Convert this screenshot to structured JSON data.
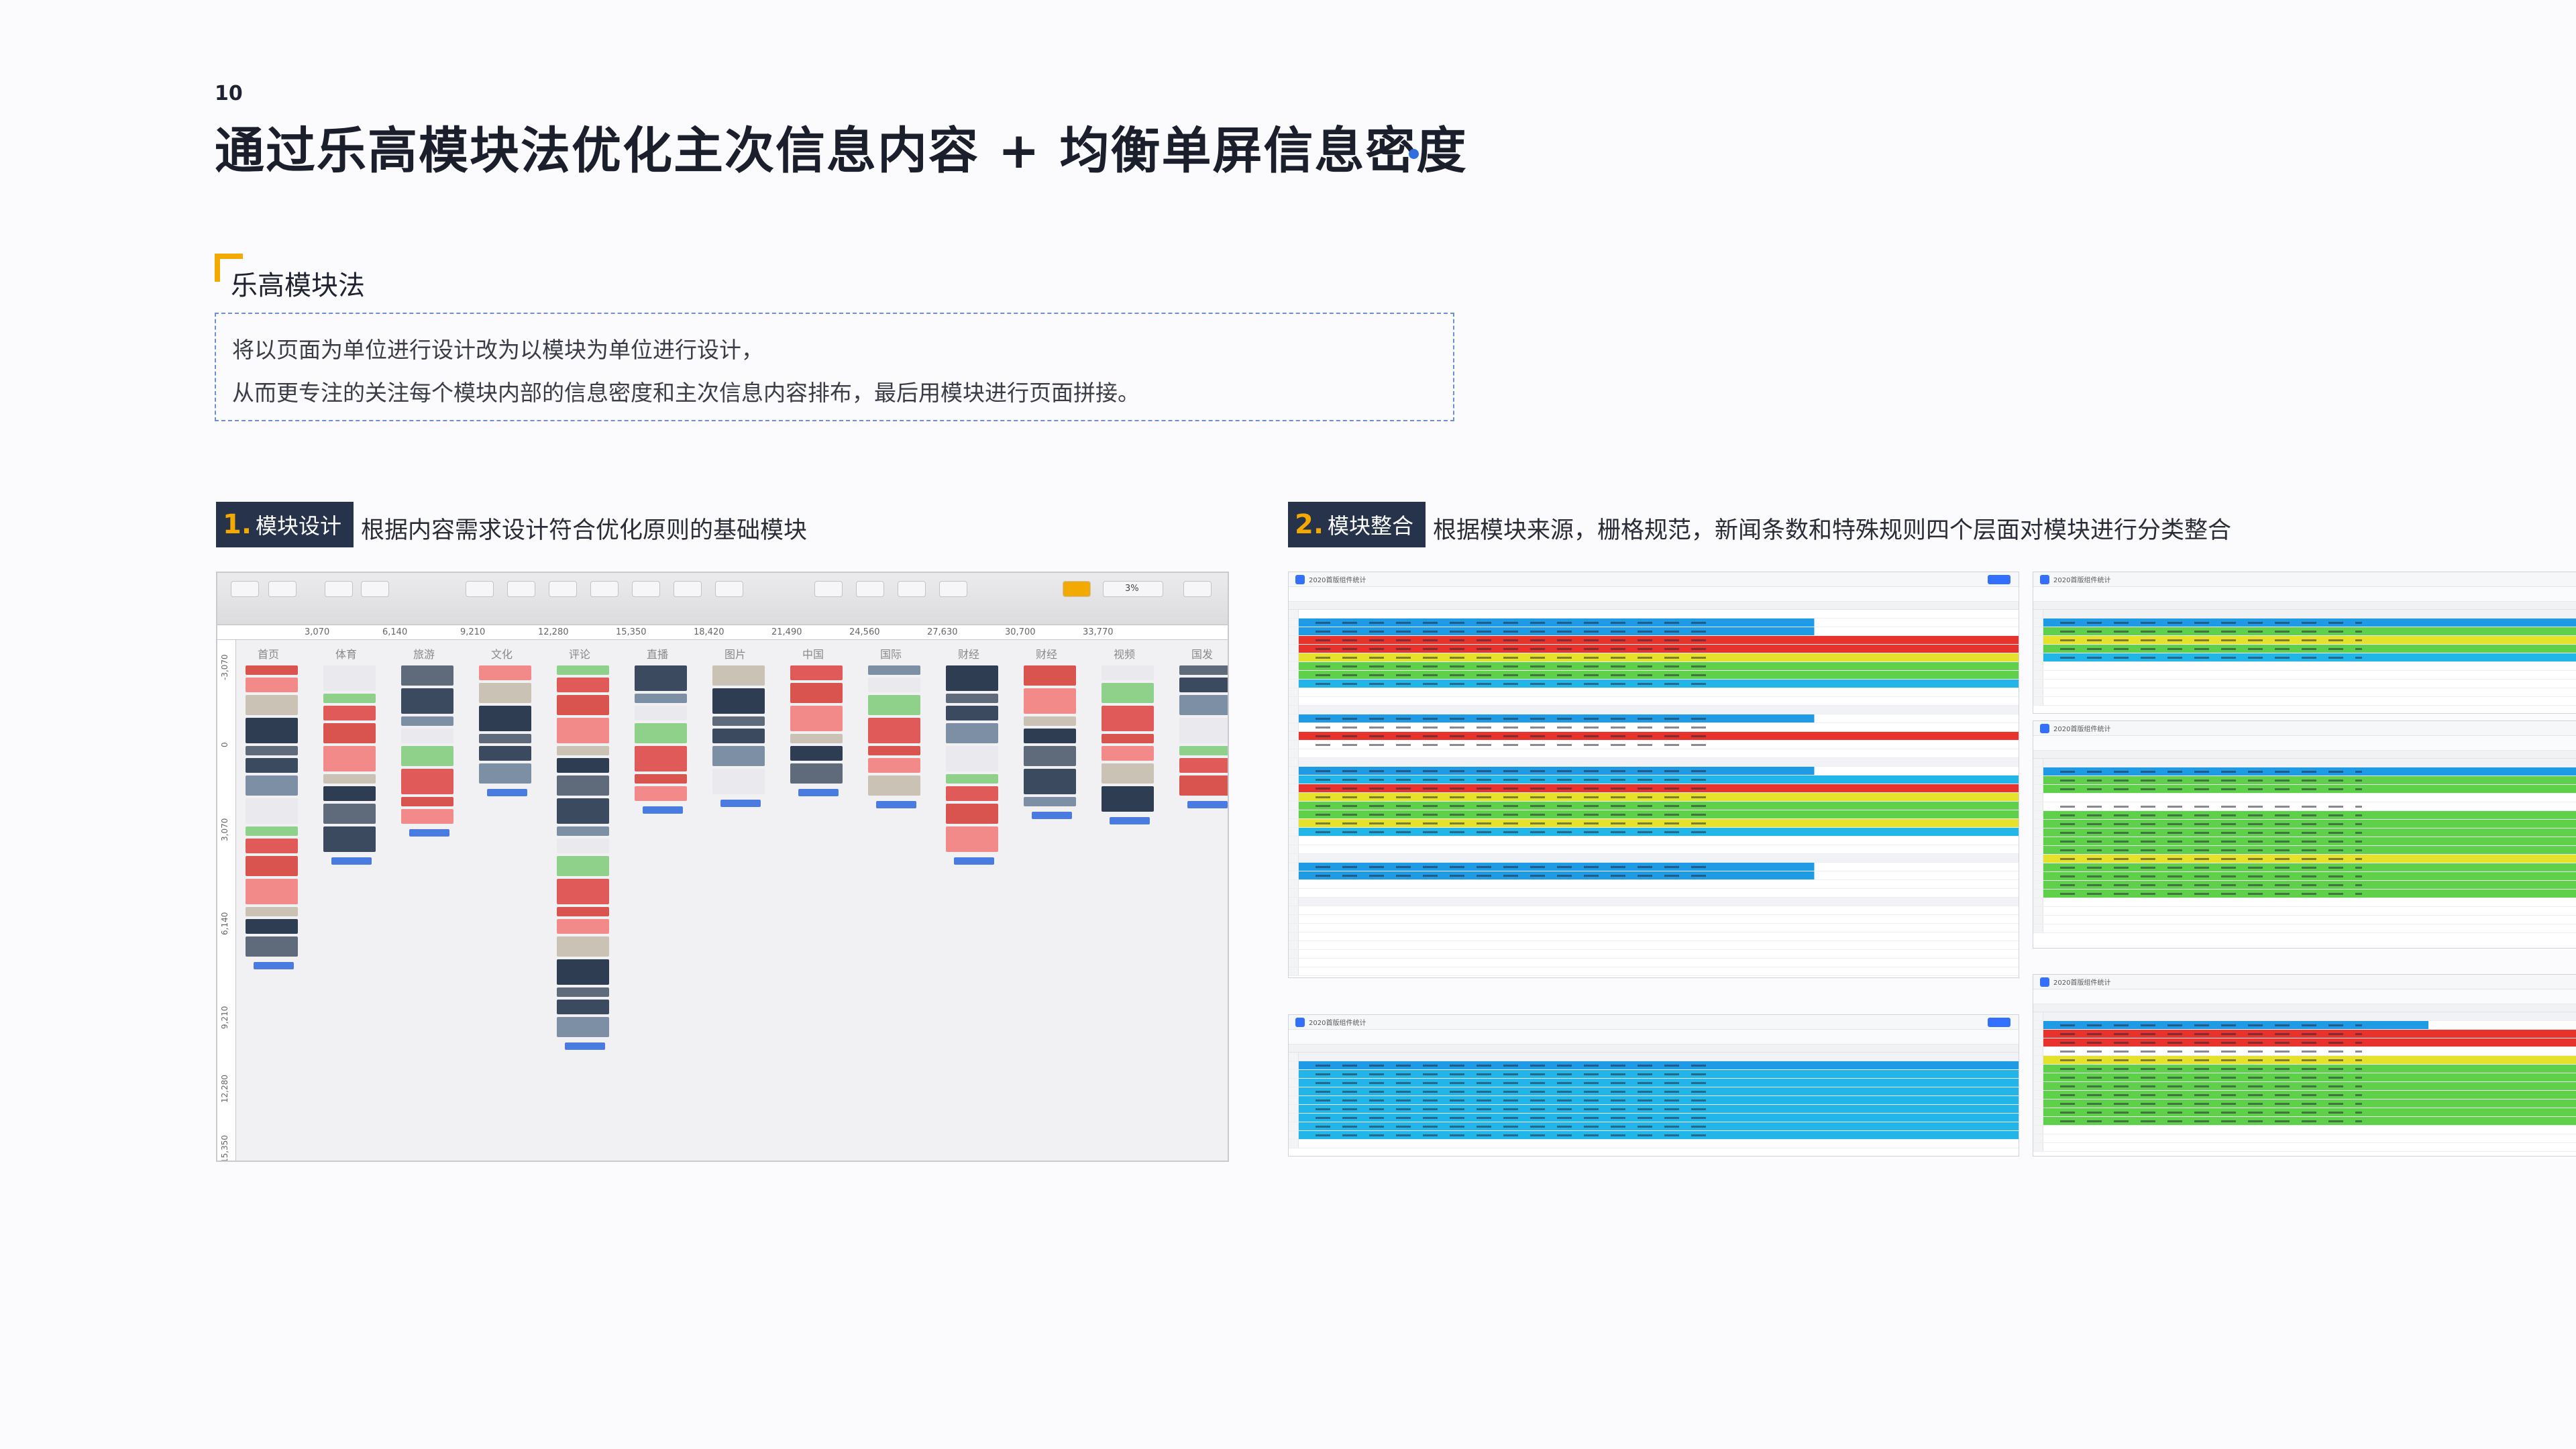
{
  "page": {
    "number": "10",
    "title": "通过乐高模块法优化主次信息内容 + 均衡单屏信息密度"
  },
  "section": {
    "title": "乐高模块法",
    "desc_lines": [
      "将以页面为单位进行设计改为以模块为单位进行设计，",
      "从而更专注的关注每个模块内部的信息密度和主次信息内容排布，最后用模块进行页面拼接。"
    ]
  },
  "steps": [
    {
      "num": "1.",
      "label": "模块设计",
      "desc": "根据内容需求设计符合优化原则的基础模块"
    },
    {
      "num": "2.",
      "label": "模块整合",
      "desc": "根据模块来源，栅格规范，新闻条数和特殊规则四个层面对模块进行分类整合"
    }
  ],
  "design_tool": {
    "ruler_top": [
      "3,070",
      "6,140",
      "9,210",
      "12,280",
      "15,350",
      "18,420",
      "21,490",
      "24,560",
      "27,630",
      "30,700",
      "33,770"
    ],
    "ruler_left": [
      "-3,070",
      "0",
      "3,070",
      "6,140",
      "9,210",
      "12,280",
      "15,350"
    ],
    "columns": [
      "首页",
      "体育",
      "旅游",
      "文化",
      "评论",
      "直播",
      "图片",
      "中国",
      "国际",
      "财经",
      "财经",
      "视频",
      "国发"
    ],
    "zoom": "3%"
  },
  "spreadsheet": {
    "title": "2020首版组件统计"
  },
  "colors": {
    "accent": "#f2a900",
    "badge_bg": "#27324b",
    "title_dot": "#2f6fe0",
    "dashed_border": "#6d8fd6"
  }
}
